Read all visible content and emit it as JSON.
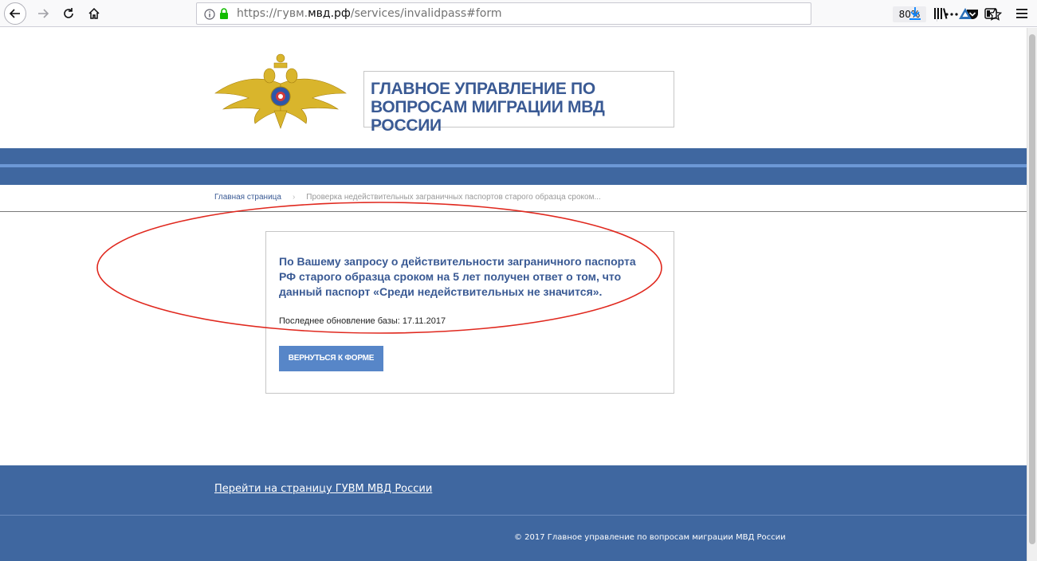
{
  "browser": {
    "url_prefix": "https://гувм.",
    "url_host": "мвд.рф",
    "url_path": "/services/invalidpass#form",
    "zoom": "80%"
  },
  "header": {
    "org_title": "ГЛАВНОЕ УПРАВЛЕНИЕ ПО\nВОПРОСАМ МИГРАЦИИ МВД РОССИИ"
  },
  "breadcrumb": {
    "home": "Главная страница",
    "separator": "›",
    "current": "Проверка недействительных заграничных паспортов старого образца сроком..."
  },
  "result": {
    "message": "По Вашему запросу о действительности заграничного паспорта РФ старого образца сроком на 5 лет получен ответ о том, что данный паспорт «Среди недействительных не значится».",
    "update_label": "Последнее обновление базы: 17.11.2017",
    "back_button": "ВЕРНУТЬСЯ К ФОРМЕ"
  },
  "footer": {
    "link": "Перейти на страницу ГУВМ МВД России",
    "copyright": "© 2017 Главное управление по вопросам миграции МВД России"
  },
  "colors": {
    "brand_blue": "#3f67a0",
    "accent_stripe": "#6c98d6",
    "button_blue": "#5786c8",
    "title_blue": "#3a5a94",
    "annotation_red": "#e0281e"
  }
}
